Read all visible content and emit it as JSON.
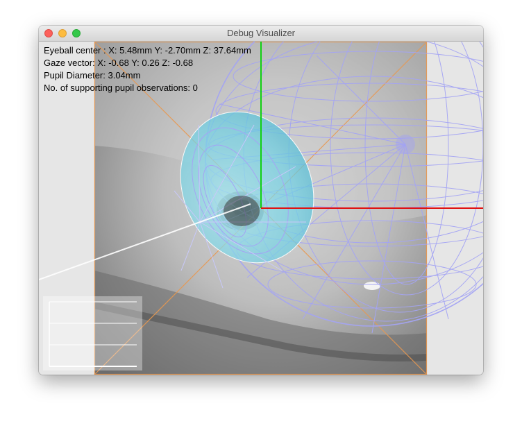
{
  "window": {
    "title": "Debug Visualizer"
  },
  "info": {
    "eyeball_center": "Eyeball center : X: 5.48mm Y: -2.70mm Z: 37.64mm",
    "gaze_vector": "Gaze vector:  X: -0.68 Y: 0.26 Z: -0.68",
    "pupil_diameter": "Pupil Diameter: 3.04mm",
    "supporting_observations": "No. of supporting pupil observations: 0"
  },
  "colors": {
    "wireframe": "#a4a4f4",
    "cornea": "#7fd4e4",
    "x_axis": "#e01010",
    "y_axis": "#10d010",
    "frustum": "#e89850",
    "gaze_ray": "#ffffff"
  }
}
